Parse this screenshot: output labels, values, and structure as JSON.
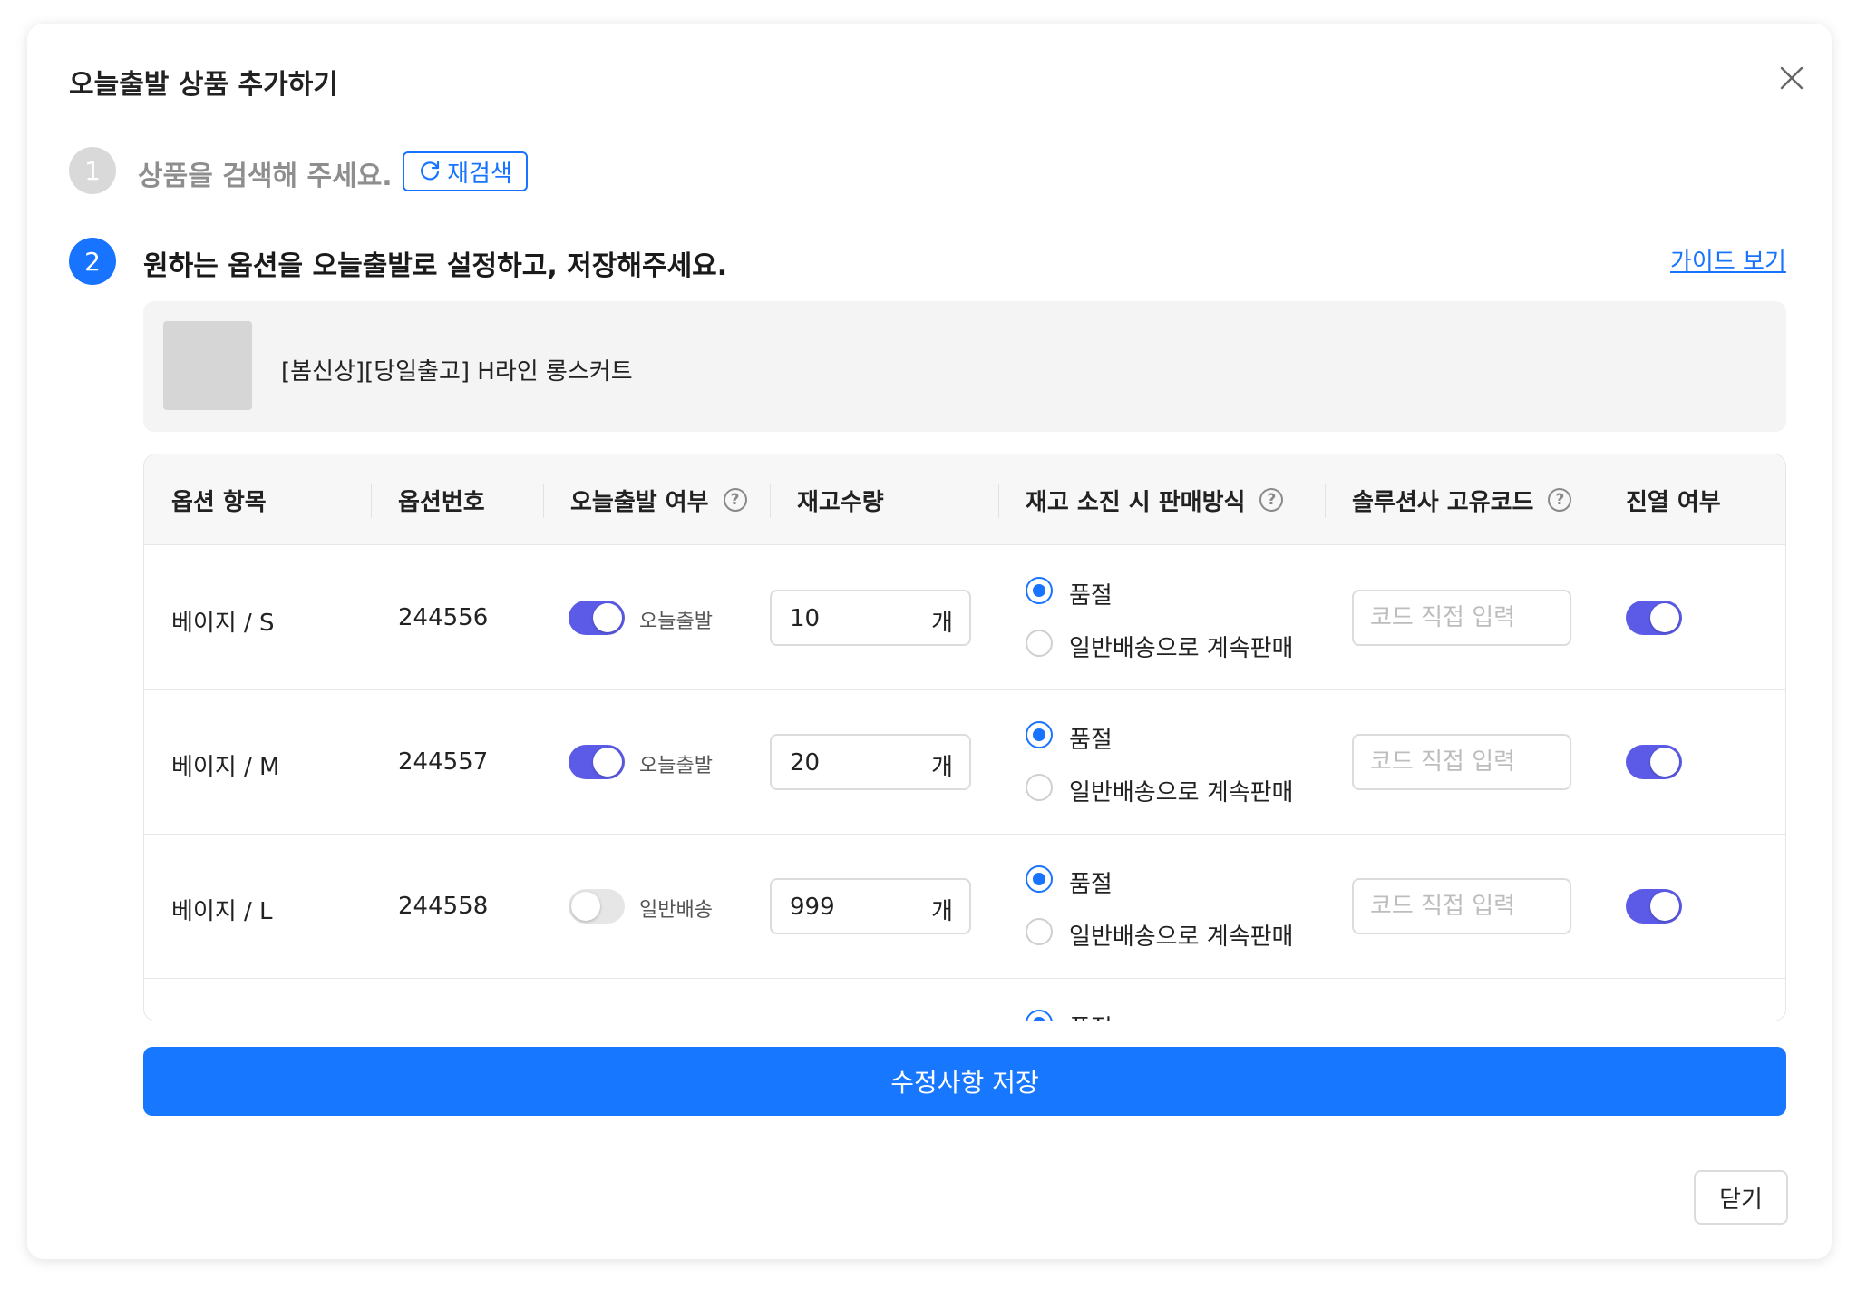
{
  "modal": {
    "title": "오늘출발 상품 추가하기",
    "close_icon": "close-icon",
    "close_button": "닫기"
  },
  "step1": {
    "number": "1",
    "text": "상품을 검색해 주세요.",
    "research_button": "재검색",
    "research_icon": "refresh-icon"
  },
  "step2": {
    "number": "2",
    "text": "원하는 옵션을 오늘출발로 설정하고, 저장해주세요.",
    "guide_link": "가이드 보기"
  },
  "product": {
    "name": "[봄신상][당일출고] H라인 롱스커트"
  },
  "table": {
    "headers": {
      "option_item": "옵션 항목",
      "option_number": "옵션번호",
      "today_ship": "오늘출발 여부",
      "stock_qty": "재고수량",
      "soldout_method": "재고 소진 시 판매방식",
      "solution_code": "솔루션사 고유코드",
      "display": "진열 여부"
    },
    "unit": "개",
    "radio_soldout": "품절",
    "radio_continue": "일반배송으로 계속판매",
    "code_placeholder": "코드 직접 입력",
    "rows": [
      {
        "option": "베이지 / S",
        "number": "244556",
        "today_ship_on": true,
        "ship_label": "오늘출발",
        "qty": "10",
        "soldout_selected": "품절",
        "display_on": true
      },
      {
        "option": "베이지 / M",
        "number": "244557",
        "today_ship_on": true,
        "ship_label": "오늘출발",
        "qty": "20",
        "soldout_selected": "품절",
        "display_on": true
      },
      {
        "option": "베이지 / L",
        "number": "244558",
        "today_ship_on": false,
        "ship_label": "일반배송",
        "qty": "999",
        "soldout_selected": "품절",
        "display_on": true
      }
    ],
    "partial_row": {
      "radio_label": "품절"
    }
  },
  "save_button": "수정사항 저장",
  "colors": {
    "primary": "#1874ff",
    "toggle_on": "#5b5be8",
    "toggle_off": "#e6e6e6"
  }
}
